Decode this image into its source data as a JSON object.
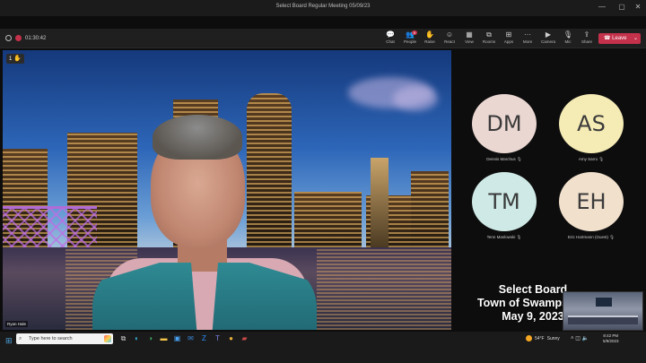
{
  "window": {
    "title": "Select Board Regular Meeting 05/09/23",
    "minimize_glyph": "—",
    "maximize_glyph": "▢",
    "close_glyph": "✕"
  },
  "toolbar": {
    "timer": "01:30:42",
    "buttons": [
      {
        "icon": "chat-icon",
        "glyph": "💬",
        "label": "Chat"
      },
      {
        "icon": "people-icon",
        "glyph": "👥",
        "label": "People",
        "badge": "9"
      },
      {
        "icon": "raise-hand-icon",
        "glyph": "✋",
        "label": "Raise"
      },
      {
        "icon": "react-icon",
        "glyph": "☺",
        "label": "React"
      },
      {
        "icon": "view-icon",
        "glyph": "▦",
        "label": "View"
      },
      {
        "icon": "rooms-icon",
        "glyph": "⧉",
        "label": "Rooms"
      },
      {
        "icon": "apps-icon",
        "glyph": "⊞",
        "label": "Apps"
      },
      {
        "icon": "more-icon",
        "glyph": "···",
        "label": "More"
      },
      {
        "icon": "camera-icon",
        "glyph": "▶",
        "label": "Camera"
      },
      {
        "icon": "mic-icon",
        "glyph": "🎙",
        "label": "Mic"
      },
      {
        "icon": "share-icon",
        "glyph": "⇪",
        "label": "Share"
      }
    ],
    "leave_label": "Leave",
    "leave_color": "#c4314b"
  },
  "main_video": {
    "raise_hand_order": "1",
    "hand_glyph": "✋",
    "speaker_name": "Ryan Hale"
  },
  "participants": [
    {
      "initials": "DM",
      "name": "Dennis Marchus",
      "color": "#ead7d2"
    },
    {
      "initials": "AS",
      "name": "Amy Sarro",
      "color": "#f5ebb5"
    },
    {
      "initials": "TM",
      "name": "Tenn Maslowski",
      "color": "#cfeae6"
    },
    {
      "initials": "EH",
      "name": "Eric Hartmann (Guest)",
      "color": "#f1e0cc"
    }
  ],
  "overlay": {
    "line1": "Select Board",
    "line2": "Town of Swampscott",
    "line3": "May 9, 2023"
  },
  "taskbar": {
    "search_placeholder": "Type here to search",
    "weather_temp": "54°F",
    "weather_desc": "Sunny",
    "time": "8:42 PM",
    "date": "5/9/2023",
    "apps": [
      {
        "icon": "task-view-icon",
        "glyph": "⧉",
        "color": "#cfcfcf"
      },
      {
        "icon": "edge-icon",
        "glyph": "◐",
        "color": "#35b6e3"
      },
      {
        "icon": "edge-beta-icon",
        "glyph": "◑",
        "color": "#3fae6a"
      },
      {
        "icon": "file-explorer-icon",
        "glyph": "▬",
        "color": "#f4c44a"
      },
      {
        "icon": "store-icon",
        "glyph": "▣",
        "color": "#4aa3f2"
      },
      {
        "icon": "mail-icon",
        "glyph": "✉",
        "color": "#3a8be0"
      },
      {
        "icon": "zoom-icon",
        "glyph": "Z",
        "color": "#2d8cff"
      },
      {
        "icon": "teams-icon",
        "glyph": "T",
        "color": "#7b83eb"
      },
      {
        "icon": "chrome-icon",
        "glyph": "●",
        "color": "#e8b23a"
      },
      {
        "icon": "recorder-icon",
        "glyph": "▰",
        "color": "#d04a4a"
      }
    ]
  }
}
